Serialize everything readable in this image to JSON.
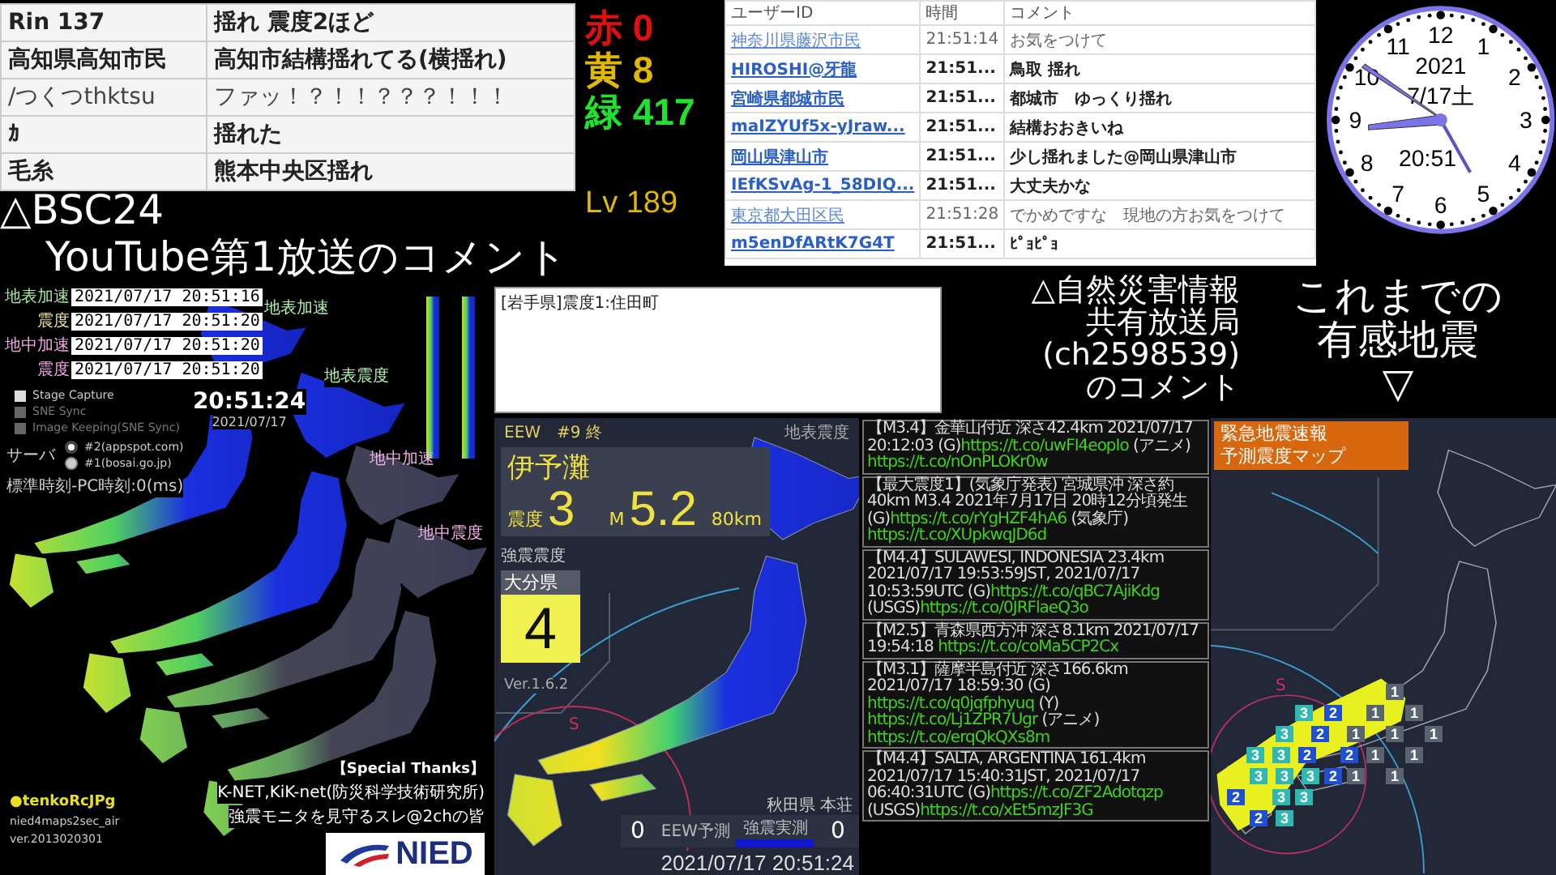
{
  "comment_board": {
    "rows": [
      {
        "user": "Rin 137",
        "comment": "揺れ 震度2ほど",
        "bold": true
      },
      {
        "user": "高知県高知市民",
        "comment": "高知市結構揺れてる(横揺れ)",
        "bold": true
      },
      {
        "user": "/つくつthktsu",
        "comment": "ファッ！？！！？？？！！！",
        "bold": false
      },
      {
        "user": "ｶ",
        "comment": "揺れた",
        "bold": true
      },
      {
        "user": "毛糸",
        "comment": "熊本中央区揺れ",
        "bold": true
      }
    ]
  },
  "counters": [
    {
      "label": "赤",
      "value": "0",
      "color": "#e01010"
    },
    {
      "label": "黄",
      "value": "8",
      "color": "#e0b800"
    },
    {
      "label": "緑",
      "value": "417",
      "color": "#20e030"
    }
  ],
  "level_text": "Lv 189",
  "heading_left": [
    "△BSC24",
    "YouTube第1放送のコメント"
  ],
  "live_comments": {
    "columns": [
      "ユーザーID",
      "時間",
      "コメント"
    ],
    "rows": [
      {
        "user": "神奈川県藤沢市民",
        "time": "21:51:14",
        "comment": "お気をつけて",
        "emphasized": false
      },
      {
        "user": "HIROSHI@牙龍",
        "time": "21:51...",
        "comment": "鳥取 揺れ",
        "emphasized": true
      },
      {
        "user": "宮崎県都城市民",
        "time": "21:51...",
        "comment": "都城市　ゆっくり揺れ",
        "emphasized": true
      },
      {
        "user": "maIZYUf5x-yJraw...",
        "time": "21:51...",
        "comment": "結構おおきいね",
        "emphasized": true
      },
      {
        "user": "岡山県津山市",
        "time": "21:51...",
        "comment": "少し揺れました@岡山県津山市",
        "emphasized": true
      },
      {
        "user": "IEfKSvAg-1_58DIQ...",
        "time": "21:51...",
        "comment": "大丈夫かな",
        "emphasized": true
      },
      {
        "user": "東京都大田区民",
        "time": "21:51:28",
        "comment": "でかめですな　現地の方お気をつけて",
        "emphasized": false
      },
      {
        "user": "m5enDfARtK7G4T",
        "time": "21:51...",
        "comment": "ﾋﾟｮﾋﾟｮ",
        "emphasized": true
      }
    ]
  },
  "clock": {
    "numerals": [
      "12",
      "1",
      "2",
      "3",
      "4",
      "5",
      "6",
      "7",
      "8",
      "9",
      "10",
      "11"
    ],
    "year": "2021",
    "date": "7/17土",
    "time": "20:51"
  },
  "monitor": {
    "timestamps": [
      {
        "label": "地表加速",
        "value": "2021/07/17  20:51:16",
        "color": "#a8e8a0"
      },
      {
        "label": "震度",
        "value": "2021/07/17  20:51:20",
        "color": "#e8e0a0"
      },
      {
        "label": "地中加速",
        "value": "2021/07/17  20:51:20",
        "color": "#f0a8e0"
      },
      {
        "label": "震度",
        "value": "2021/07/17  20:51:20",
        "color": "#f0a8e0"
      }
    ],
    "options": [
      {
        "label": "Stage Capture",
        "disabled": false
      },
      {
        "label": "SNE Sync",
        "disabled": true
      },
      {
        "label": "Image Keeping(SNE Sync)",
        "disabled": true
      }
    ],
    "server_label": "サーバ",
    "servers": [
      {
        "label": "#2(appspot.com)",
        "selected": true
      },
      {
        "label": "#1(bosai.go.jp)",
        "selected": false
      }
    ],
    "offset_text": "標準時刻-PC時刻:0(ms)",
    "time": "20:51:24",
    "date": "2021/07/17",
    "map_labels": [
      "地表加速",
      "地表震度",
      "地中加速",
      "地中震度"
    ],
    "credit_name": "●tenkoRcJPg",
    "credit_app": "nied4maps2sec_air",
    "credit_version": "ver.2013020301",
    "thanks_title": "【Special Thanks】",
    "thanks_lines": [
      "K-NET,KiK-net(防災科学技術研究所)",
      "強震モニタを見守るスレ@2chの皆"
    ],
    "logo_text": "NIED"
  },
  "latest_report": "[岩手県]震度1:住田町",
  "heading_news": [
    "△自然災害情報",
    "共有放送局",
    "(ch2598539)",
    "のコメント"
  ],
  "heading_history": [
    "これまでの",
    "有感地震",
    "▽"
  ],
  "eew": {
    "header": "EEW　#9 終",
    "map_type": "地表震度",
    "region": "伊予灘",
    "intensity_label": "震度",
    "intensity": "3",
    "magnitude_label": "M",
    "magnitude": "5.2",
    "depth": "80km",
    "strong_label": "強震震度",
    "strong_pref": "大分県",
    "strong_value": "4",
    "version": "Ver.1.6.2",
    "circle_label": "S",
    "station": "秋田県 本荘",
    "eew_count": "0",
    "eew_label": "EEW予測",
    "measured_label": "強震実測",
    "measured_count": "0",
    "datetime": "2021/07/17  20:51:24"
  },
  "news": [
    {
      "segments": [
        {
          "text": "【M3.4】金華山付近 深さ42.4km 2021/07/17 20:12:03 (G)",
          "kind": "text"
        },
        {
          "text": "https://t.co/uwFI4eopIo",
          "kind": "link"
        },
        {
          "text": " (アニメ) ",
          "kind": "text"
        },
        {
          "text": "https://t.co/nOnPLOKr0w",
          "kind": "link"
        }
      ]
    },
    {
      "segments": [
        {
          "text": "【最大震度1】(気象庁発表) 宮城県沖 深さ約40km M3.4 2021年7月17日 20時12分頃発生 (G)",
          "kind": "text"
        },
        {
          "text": "https://t.co/rYgHZF4hA6",
          "kind": "link"
        },
        {
          "text": " (気象庁) ",
          "kind": "text"
        },
        {
          "text": "https://t.co/XUpkwqJD6d",
          "kind": "link"
        }
      ]
    },
    {
      "segments": [
        {
          "text": "【M4.4】SULAWESI, INDONESIA 23.4km 2021/07/17 19:53:59JST, 2021/07/17 10:53:59UTC (G)",
          "kind": "text"
        },
        {
          "text": "https://t.co/qBC7AjiKdg",
          "kind": "link"
        },
        {
          "text": " (USGS)",
          "kind": "text"
        },
        {
          "text": "https://t.co/0JRFlaeQ3o",
          "kind": "link"
        }
      ]
    },
    {
      "segments": [
        {
          "text": "【M2.5】青森県西方沖 深さ8.1km 2021/07/17 19:54:18 ",
          "kind": "text"
        },
        {
          "text": "https://t.co/coMa5CP2Cx",
          "kind": "link"
        }
      ]
    },
    {
      "segments": [
        {
          "text": "【M3.1】薩摩半島付近 深さ166.6km 2021/07/17 18:59:30 (G) ",
          "kind": "text"
        },
        {
          "text": "https://t.co/q0jqfphyuq",
          "kind": "link"
        },
        {
          "text": " (Y) ",
          "kind": "text"
        },
        {
          "text": "https://t.co/Lj1ZPR7Ugr",
          "kind": "link"
        },
        {
          "text": " (アニメ) ",
          "kind": "text"
        },
        {
          "text": "https://t.co/erqQkQXs8m",
          "kind": "link"
        }
      ]
    },
    {
      "segments": [
        {
          "text": "【M4.4】SALTA, ARGENTINA 161.4km 2021/07/17 15:40:31JST, 2021/07/17 06:40:31UTC (G)",
          "kind": "text"
        },
        {
          "text": "https://t.co/ZF2Adotqzp",
          "kind": "link"
        },
        {
          "text": " (USGS)",
          "kind": "text"
        },
        {
          "text": "https://t.co/xEt5mzJF3G",
          "kind": "link"
        }
      ]
    }
  ],
  "forecast_map": {
    "title": [
      "緊急地震速報",
      "予測震度マップ"
    ],
    "circle_label": "S",
    "markers": [
      {
        "label": "1",
        "color": "#5a6470"
      },
      {
        "label": "3",
        "color": "#30b8b0"
      },
      {
        "label": "2",
        "color": "#2050d0"
      },
      {
        "label": "1",
        "color": "#5a6470"
      },
      {
        "label": "1",
        "color": "#5a6470"
      },
      {
        "label": "3",
        "color": "#30b8b0"
      },
      {
        "label": "2",
        "color": "#2050d0"
      },
      {
        "label": "1",
        "color": "#5a6470"
      },
      {
        "label": "1",
        "color": "#5a6470"
      },
      {
        "label": "1",
        "color": "#5a6470"
      },
      {
        "label": "3",
        "color": "#30b8b0"
      },
      {
        "label": "3",
        "color": "#30b8b0"
      },
      {
        "label": "2",
        "color": "#2050d0"
      },
      {
        "label": "2",
        "color": "#2050d0"
      },
      {
        "label": "1",
        "color": "#5a6470"
      },
      {
        "label": "1",
        "color": "#5a6470"
      },
      {
        "label": "3",
        "color": "#30b8b0"
      },
      {
        "label": "3",
        "color": "#30b8b0"
      },
      {
        "label": "3",
        "color": "#30b8b0"
      },
      {
        "label": "2",
        "color": "#2050d0"
      },
      {
        "label": "1",
        "color": "#5a6470"
      },
      {
        "label": "1",
        "color": "#5a6470"
      },
      {
        "label": "2",
        "color": "#2050d0"
      },
      {
        "label": "3",
        "color": "#30b8b0"
      },
      {
        "label": "3",
        "color": "#30b8b0"
      },
      {
        "label": "2",
        "color": "#2050d0"
      },
      {
        "label": "3",
        "color": "#30b8b0"
      }
    ]
  }
}
